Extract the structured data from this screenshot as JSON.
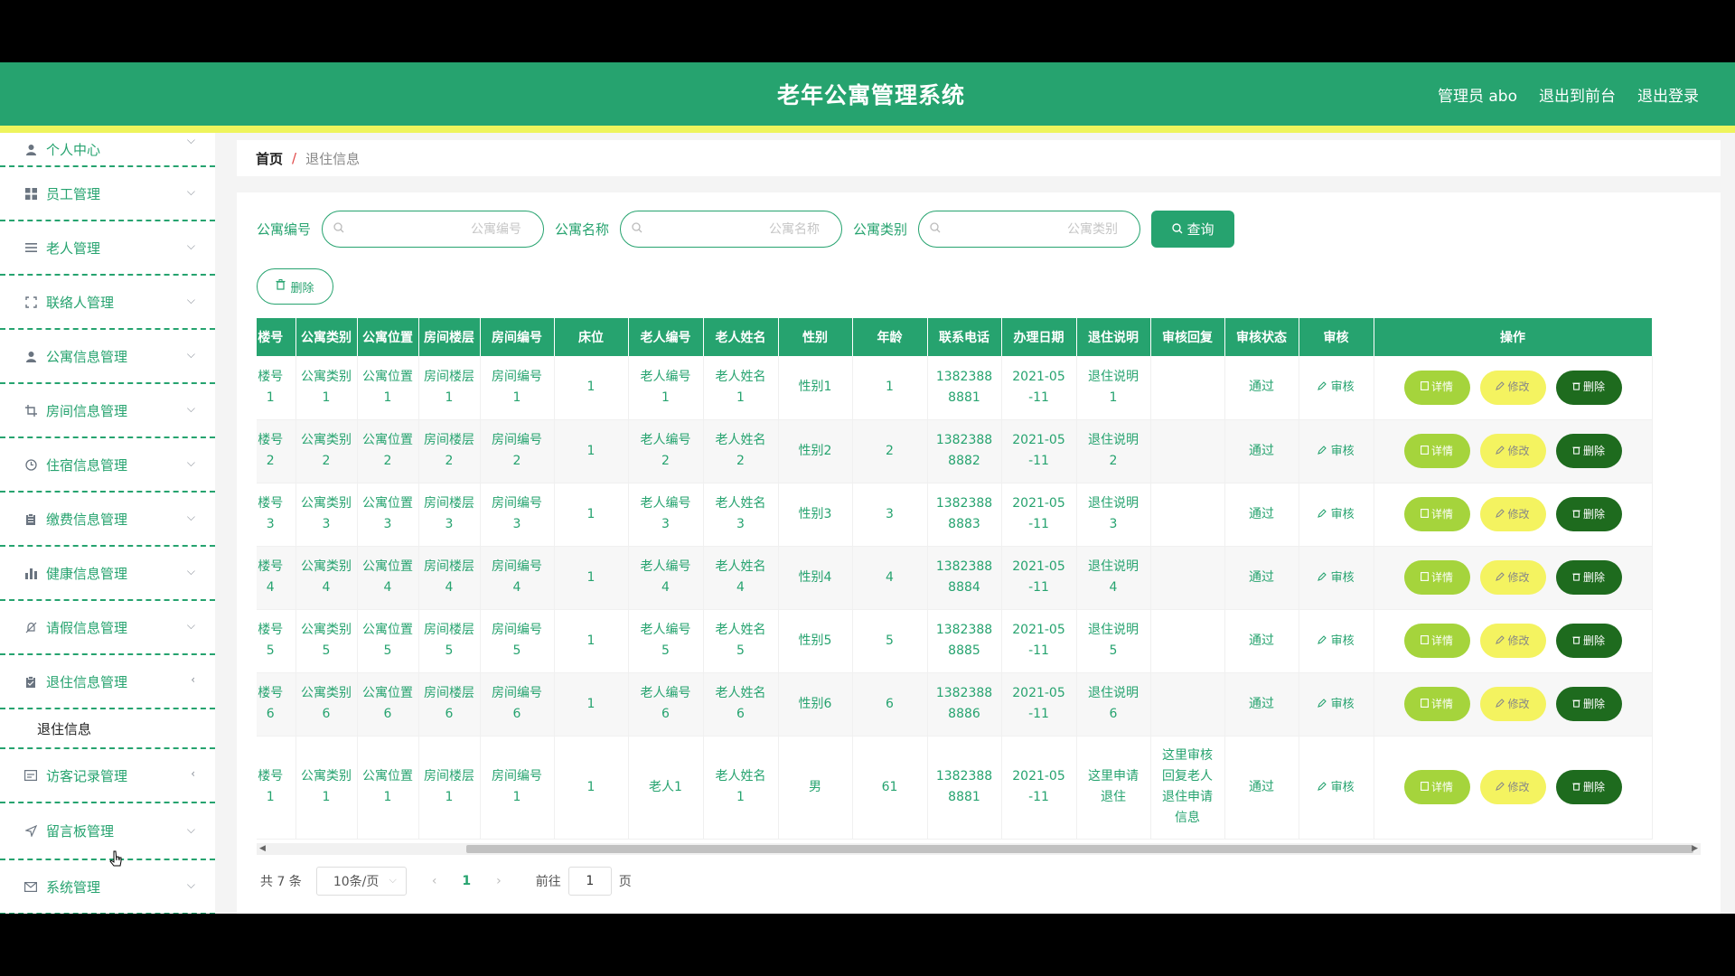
{
  "header": {
    "title": "老年公寓管理系统",
    "admin_label": "管理员 abo",
    "to_front": "退出到前台",
    "logout": "退出登录"
  },
  "sidebar": {
    "items": [
      {
        "label": "个人中心",
        "icon": "user-icon"
      },
      {
        "label": "员工管理",
        "icon": "grid-icon"
      },
      {
        "label": "老人管理",
        "icon": "list-icon"
      },
      {
        "label": "联络人管理",
        "icon": "fullscreen-icon"
      },
      {
        "label": "公寓信息管理",
        "icon": "user-icon"
      },
      {
        "label": "房间信息管理",
        "icon": "crop-icon"
      },
      {
        "label": "住宿信息管理",
        "icon": "clock-icon"
      },
      {
        "label": "缴费信息管理",
        "icon": "clipboard-icon"
      },
      {
        "label": "健康信息管理",
        "icon": "bar-chart-icon"
      },
      {
        "label": "请假信息管理",
        "icon": "bell-off-icon"
      },
      {
        "label": "退住信息管理",
        "icon": "clipboard-check-icon"
      },
      {
        "label": "访客记录管理",
        "icon": "card-icon"
      },
      {
        "label": "留言板管理",
        "icon": "send-icon"
      },
      {
        "label": "系统管理",
        "icon": "mail-icon"
      }
    ],
    "submenu": "退住信息"
  },
  "breadcrumb": {
    "home": "首页",
    "sep": "/",
    "current": "退住信息"
  },
  "filters": {
    "f1_label": "公寓编号",
    "f1_placeholder": "公寓编号",
    "f2_label": "公寓名称",
    "f2_placeholder": "公寓名称",
    "f3_label": "公寓类别",
    "f3_placeholder": "公寓类别",
    "query": "查询"
  },
  "delete_label": "删除",
  "table": {
    "columns": [
      "楼号",
      "公寓类别",
      "公寓位置",
      "房间楼层",
      "房间编号",
      "床位",
      "老人编号",
      "老人姓名",
      "性别",
      "年龄",
      "联系电话",
      "办理日期",
      "退住说明",
      "审核回复",
      "审核状态",
      "审核",
      "操作"
    ],
    "rows": [
      [
        "楼号\n1",
        "公寓类别\n1",
        "公寓位置\n1",
        "房间楼层\n1",
        "房间编号\n1",
        "1",
        "老人编号\n1",
        "老人姓名\n1",
        "性别1",
        "1",
        "1382388\n8881",
        "2021-05\n-11",
        "退住说明\n1",
        "",
        "通过"
      ],
      [
        "楼号\n2",
        "公寓类别\n2",
        "公寓位置\n2",
        "房间楼层\n2",
        "房间编号\n2",
        "1",
        "老人编号\n2",
        "老人姓名\n2",
        "性别2",
        "2",
        "1382388\n8882",
        "2021-05\n-11",
        "退住说明\n2",
        "",
        "通过"
      ],
      [
        "楼号\n3",
        "公寓类别\n3",
        "公寓位置\n3",
        "房间楼层\n3",
        "房间编号\n3",
        "1",
        "老人编号\n3",
        "老人姓名\n3",
        "性别3",
        "3",
        "1382388\n8883",
        "2021-05\n-11",
        "退住说明\n3",
        "",
        "通过"
      ],
      [
        "楼号\n4",
        "公寓类别\n4",
        "公寓位置\n4",
        "房间楼层\n4",
        "房间编号\n4",
        "1",
        "老人编号\n4",
        "老人姓名\n4",
        "性别4",
        "4",
        "1382388\n8884",
        "2021-05\n-11",
        "退住说明\n4",
        "",
        "通过"
      ],
      [
        "楼号\n5",
        "公寓类别\n5",
        "公寓位置\n5",
        "房间楼层\n5",
        "房间编号\n5",
        "1",
        "老人编号\n5",
        "老人姓名\n5",
        "性别5",
        "5",
        "1382388\n8885",
        "2021-05\n-11",
        "退住说明\n5",
        "",
        "通过"
      ],
      [
        "楼号\n6",
        "公寓类别\n6",
        "公寓位置\n6",
        "房间楼层\n6",
        "房间编号\n6",
        "1",
        "老人编号\n6",
        "老人姓名\n6",
        "性别6",
        "6",
        "1382388\n8886",
        "2021-05\n-11",
        "退住说明\n6",
        "",
        "通过"
      ],
      [
        "楼号\n1",
        "公寓类别\n1",
        "公寓位置\n1",
        "房间楼层\n1",
        "房间编号\n1",
        "1",
        "老人1",
        "老人姓名\n1",
        "男",
        "61",
        "1382388\n8881",
        "2021-05\n-11",
        "这里申请\n退住",
        "这里审核\n回复老人\n退住申请\n信息",
        "通过"
      ]
    ],
    "audit_label": "审核",
    "detail_label": "详情",
    "edit_label": "修改",
    "row_delete_label": "删除"
  },
  "pager": {
    "total": "共 7 条",
    "page_size": "10条/页",
    "current_page": "1",
    "goto_label": "前往",
    "goto_value": "1",
    "page_unit": "页"
  },
  "colors": {
    "primary": "#26a36f",
    "accent_yellow": "#eef45c",
    "detail_btn": "#a5d43c",
    "edit_btn": "#f4f360",
    "delete_btn": "#1e6b1e"
  }
}
